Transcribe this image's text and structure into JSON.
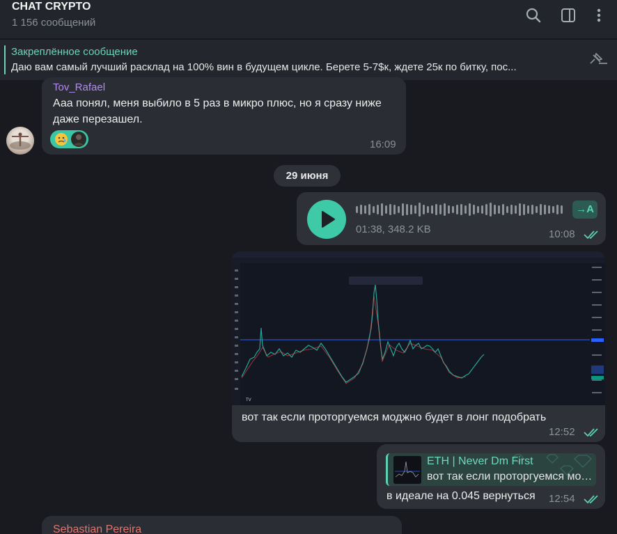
{
  "header": {
    "title": "CHAT CRYPTO",
    "subtitle": "1 156 сообщений",
    "icons": [
      "search-icon",
      "sidebar-toggle-icon",
      "more-vertical-icon"
    ]
  },
  "pinned": {
    "title": "Закреплённое сообщение",
    "text": "Даю вам самый лучший расклад на 100% вин в будущем цикле. Берете 5-7$к, ждете 25к по битку, пос...",
    "icon": "unpin-icon"
  },
  "messages": [
    {
      "sender": "Tov_Rafael",
      "sender_color": "#b48cf0",
      "line1": "Ааа понял, меня выбило в 5 раз в микро плюс, но я сразу ниже",
      "line2": "даже перезашел.",
      "time": "16:09",
      "reaction": "😢"
    }
  ],
  "date_chip": "29 июня",
  "voice": {
    "meta": "01:38, 348.2 KB",
    "time": "10:08",
    "transcribe_label": "→A"
  },
  "photo_msg": {
    "caption": "вот так если проторгуемся моджно будет в лонг подобрать",
    "time": "12:52"
  },
  "reply_msg": {
    "reply_name": "ETH | Never Dm First",
    "reply_text": "вот так если проторгуемся можно будет в лонг подобрать",
    "text": "в идеале на 0.045 вернуться",
    "time": "12:54"
  },
  "bottom_sender": "Sebastian Pereira",
  "colors": {
    "accent": "#3ec9a7",
    "background": "#181a1f",
    "bubble": "#2e3137"
  }
}
